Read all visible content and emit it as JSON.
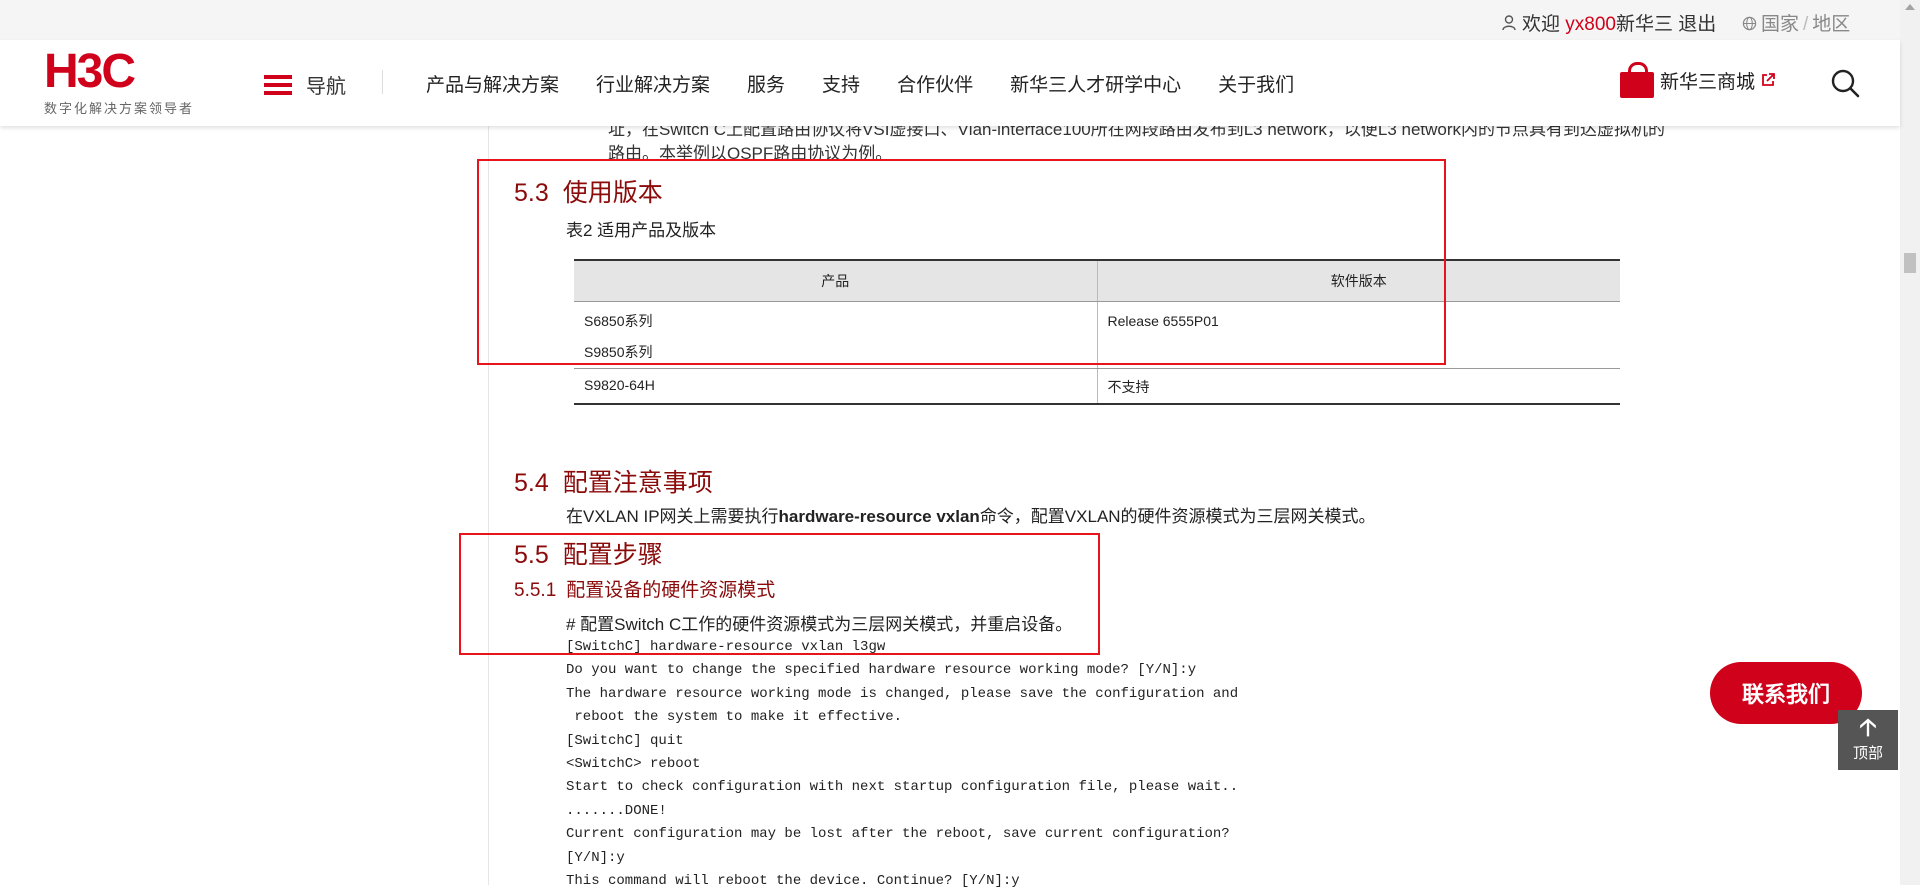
{
  "topbar": {
    "welcome": "欢迎",
    "username": "yx800",
    "site_name": "新华三",
    "logout": "退出",
    "region_country": "国家",
    "region_sep": "/",
    "region_area": "地区"
  },
  "header": {
    "logo_text": "H3C",
    "logo_tagline": "数字化解决方案领导者",
    "nav_toggle": "导航",
    "nav_items": [
      "产品与解决方案",
      "行业解决方案",
      "服务",
      "支持",
      "合作伙伴",
      "新华三人才研学中心",
      "关于我们"
    ],
    "mall": "新华三商城"
  },
  "article": {
    "intro_text": "址，在Switch C上配置路由协议将VSI虚接口、Vlan-interface100所在网段路由发布到L3 network，以便L3 network内的节点具有到达虚拟机的路由。本举例以OSPF路由协议为例。",
    "s53": {
      "num": "5.3",
      "title": "使用版本"
    },
    "table_caption": "表2 适用产品及版本",
    "table": {
      "headers": [
        "产品",
        "软件版本"
      ],
      "rows": [
        {
          "product_line1": "S6850系列",
          "product_line2": "S9850系列",
          "version": "Release 6555P01"
        },
        {
          "product_line1": "S9820-64H",
          "version": "不支持"
        }
      ]
    },
    "s54": {
      "num": "5.4",
      "title": "配置注意事项"
    },
    "s54_text_pre": "在VXLAN IP网关上需要执行",
    "s54_text_bold": "hardware-resource vxlan",
    "s54_text_post": "命令，配置VXLAN的硬件资源模式为三层网关模式。",
    "s55": {
      "num": "5.5",
      "title": "配置步骤"
    },
    "s551": {
      "num": "5.5.1",
      "title": "配置设备的硬件资源模式"
    },
    "step_comment": "# 配置Switch C工作的硬件资源模式为三层网关模式，并重启设备。",
    "code_lines": [
      "[SwitchC] hardware-resource vxlan l3gw",
      "Do you want to change the specified hardware resource working mode? [Y/N]:y",
      "The hardware resource working mode is changed, please save the configuration and",
      " reboot the system to make it effective.",
      "[SwitchC] quit",
      "<SwitchC> reboot",
      "Start to check configuration with next startup configuration file, please wait..",
      ".......DONE!",
      "Current configuration may be lost after the reboot, save current configuration?",
      "[Y/N]:y",
      "This command will reboot the device. Continue? [Y/N]:y"
    ]
  },
  "floating": {
    "contact_us": "联系我们",
    "to_top": "顶部"
  },
  "colors": {
    "brand_red": "#d0021b",
    "heading_red": "#8b0a0a",
    "annotation_red": "#e8141b"
  }
}
